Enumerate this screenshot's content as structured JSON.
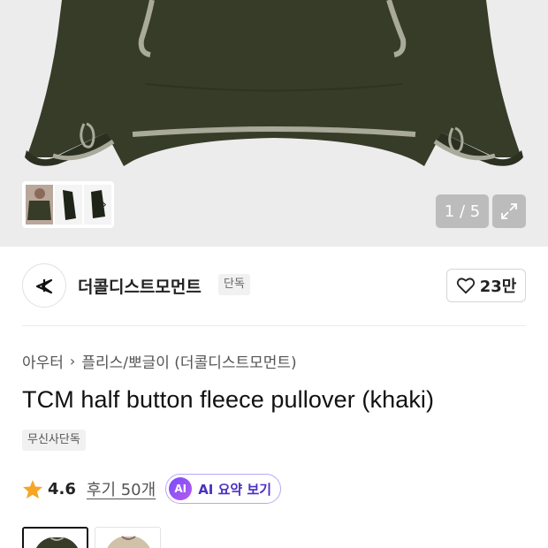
{
  "gallery": {
    "counter": "1 / 5",
    "current_image": 1,
    "total_images": 5,
    "thumbnails": [
      "thumb-front-model",
      "thumb-flat-side",
      "thumb-flat-back"
    ]
  },
  "brand": {
    "name": "더콜디스트모먼트",
    "badge": "단독",
    "like_count": "23만"
  },
  "breadcrumb": {
    "category": "아우터",
    "subcategory": "플리스/뽀글이 (더콜디스트모먼트)"
  },
  "product": {
    "title": "TCM half button fleece pullover (khaki)",
    "exclusive_badge": "무신사단독",
    "rating": "4.6",
    "review_label": "후기 50개",
    "ai_icon_text": "AI",
    "ai_summary_label": "AI 요약 보기"
  },
  "colors": {
    "garment": "#363c28",
    "trim": "#a9aa9a",
    "rating_star": "#f5a623",
    "ai_accent": "#6b3cf0"
  },
  "swatches": [
    {
      "name": "khaki",
      "selected": true
    },
    {
      "name": "beige",
      "selected": false
    }
  ]
}
